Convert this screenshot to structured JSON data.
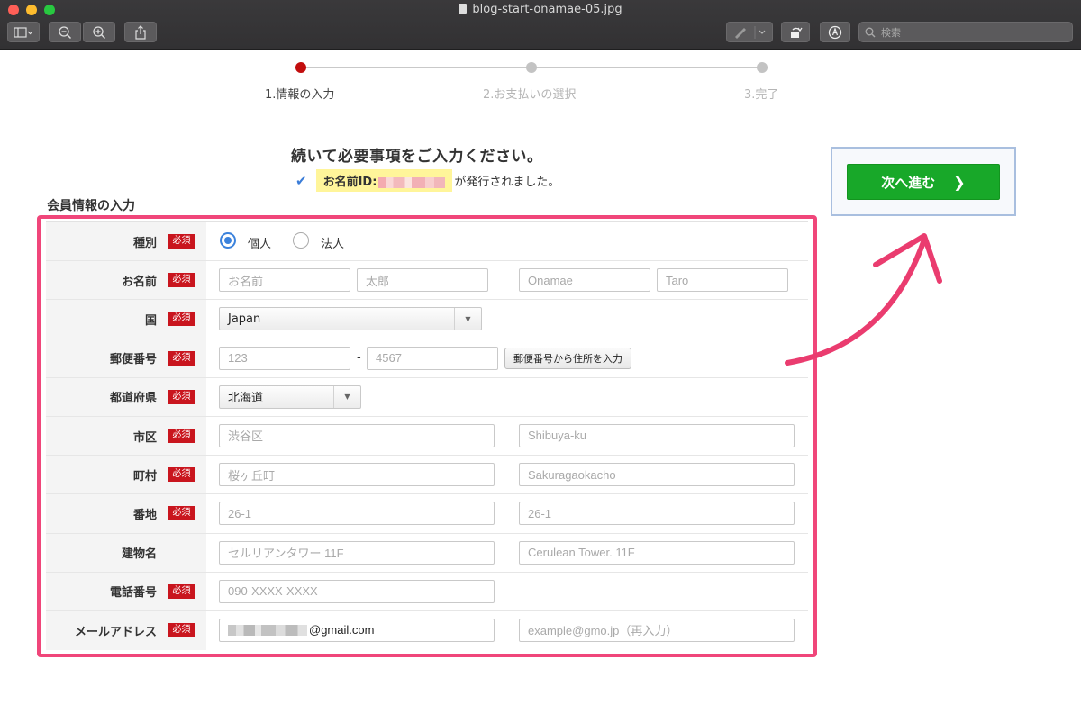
{
  "window": {
    "title": "blog-start-onamae-05.jpg",
    "search_placeholder": "検索"
  },
  "steps": [
    {
      "label": "1.情報の入力",
      "active": true
    },
    {
      "label": "2.お支払いの選択",
      "active": false
    },
    {
      "label": "3.完了",
      "active": false
    }
  ],
  "lead": "続いて必要事項をご入力ください。",
  "issued": {
    "id_label": "お名前ID:",
    "suffix": "が発行されました。"
  },
  "section_title": "会員情報の入力",
  "next_button": "次へ進む",
  "required_badge": "必須",
  "form": {
    "type": {
      "label": "種別",
      "options": [
        "個人",
        "法人"
      ],
      "selected": "個人"
    },
    "name": {
      "label": "お名前",
      "placeholders": [
        "お名前",
        "太郎",
        "Onamae",
        "Taro"
      ]
    },
    "country": {
      "label": "国",
      "value": "Japan"
    },
    "zip": {
      "label": "郵便番号",
      "placeholders": [
        "123",
        "4567"
      ],
      "separator": "-",
      "button": "郵便番号から住所を入力"
    },
    "prefecture": {
      "label": "都道府県",
      "value": "北海道"
    },
    "city": {
      "label": "市区",
      "placeholders": [
        "渋谷区",
        "Shibuya-ku"
      ]
    },
    "town": {
      "label": "町村",
      "placeholders": [
        "桜ヶ丘町",
        "Sakuragaokacho"
      ]
    },
    "address": {
      "label": "番地",
      "placeholders": [
        "26-1",
        "26-1"
      ]
    },
    "building": {
      "label": "建物名",
      "placeholders": [
        "セルリアンタワー 11F",
        "Cerulean Tower. 11F"
      ]
    },
    "phone": {
      "label": "電話番号",
      "placeholder": "090-XXXX-XXXX"
    },
    "email": {
      "label": "メールアドレス",
      "value_suffix": "@gmail.com",
      "confirm_placeholder": "example@gmo.jp（再入力）"
    }
  },
  "colors": {
    "accent_red": "#c20d0d",
    "required_red": "#c9151e",
    "next_green": "#18a829",
    "highlight_pink": "#f0467a",
    "radio_blue": "#3b82dc"
  }
}
